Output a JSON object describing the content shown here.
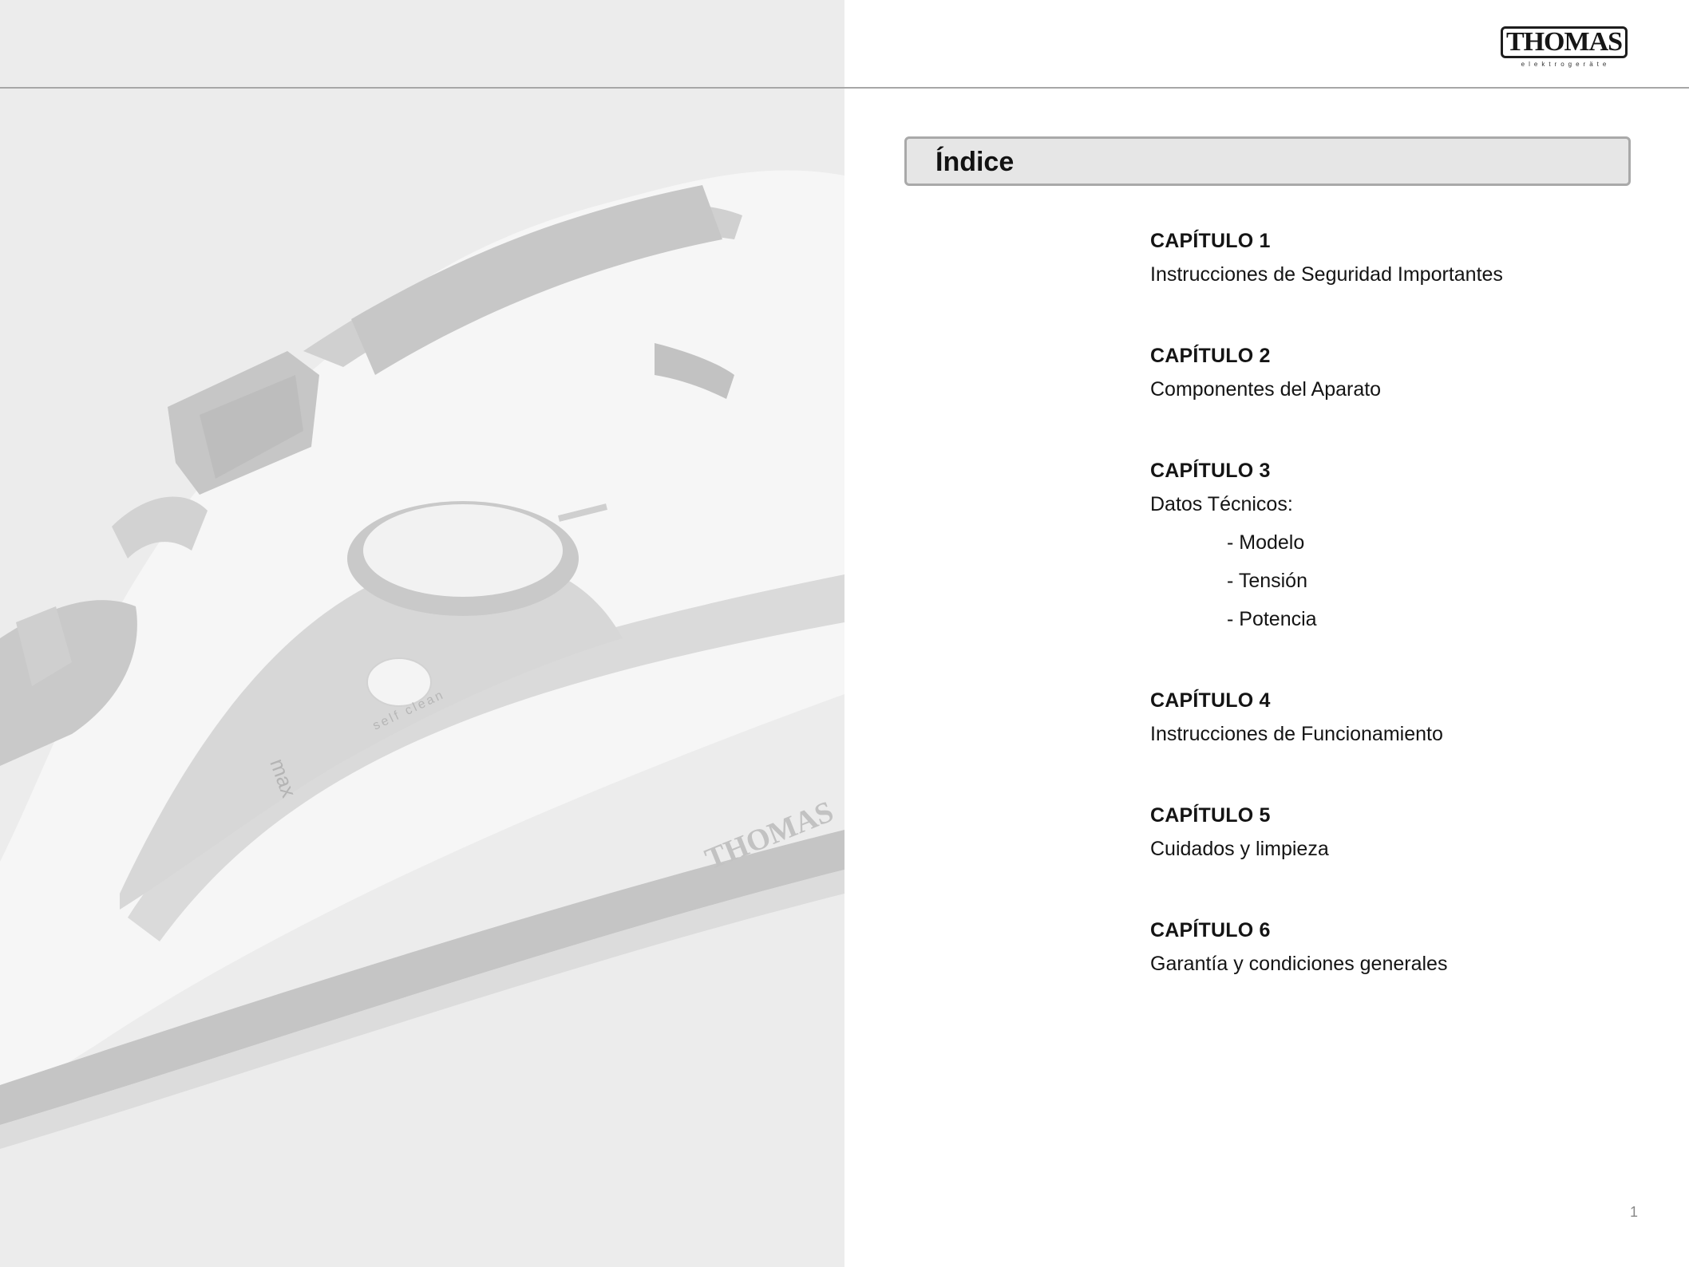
{
  "logo": {
    "brand": "THOMAS",
    "tagline": "elektrogeräte"
  },
  "index": {
    "title": "Índice"
  },
  "chapters": [
    {
      "label": "CAPÍTULO 1",
      "title": "Instrucciones de Seguridad Importantes"
    },
    {
      "label": "CAPÍTULO 2",
      "title": "Componentes del Aparato"
    },
    {
      "label": "CAPÍTULO 3",
      "title": "Datos Técnicos:",
      "items": [
        "- Modelo",
        "- Tensión",
        "- Potencia"
      ]
    },
    {
      "label": "CAPÍTULO 4",
      "title": "Instrucciones de Funcionamiento"
    },
    {
      "label": "CAPÍTULO 5",
      "title": "Cuidados y limpieza"
    },
    {
      "label": "CAPÍTULO 6",
      "title": "Garantía y condiciones generales"
    }
  ],
  "illustration": {
    "subject": "steam iron",
    "labels": {
      "self_clean": "self clean",
      "max": "max",
      "brand": "THOMAS"
    }
  },
  "page_number": "1",
  "colors": {
    "panel_background": "#ececec",
    "rule": "#a7a7a7",
    "index_bar_fill": "#e6e6e6",
    "index_bar_border": "#a9a9a9"
  }
}
